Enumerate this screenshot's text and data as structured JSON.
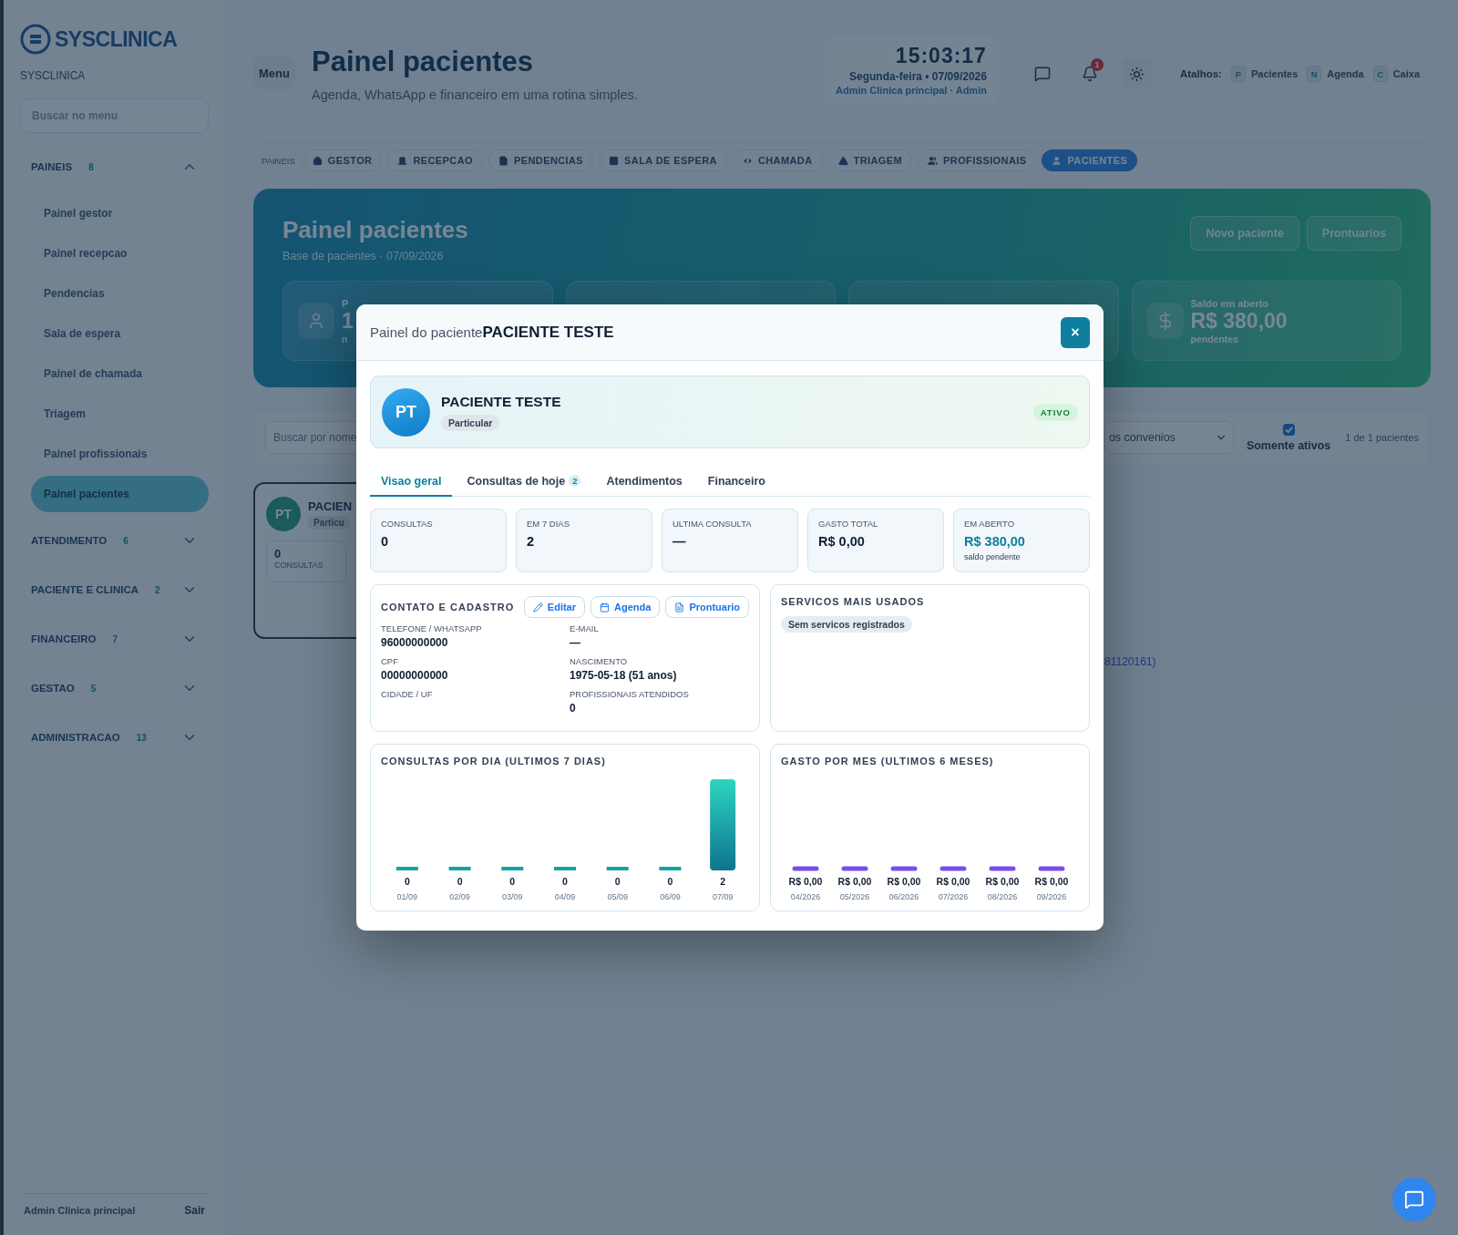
{
  "sidebar": {
    "logo": "SYSCLINICA",
    "subtitle": "SYSCLINICA",
    "search": {
      "placeholder": "Buscar no menu"
    },
    "groups": [
      {
        "label": "PAINEIS",
        "count": "8",
        "expanded": true,
        "items": [
          {
            "label": "Painel gestor",
            "selected": false
          },
          {
            "label": "Painel recepcao",
            "selected": false
          },
          {
            "label": "Pendencias",
            "selected": false
          },
          {
            "label": "Sala de espera",
            "selected": false
          },
          {
            "label": "Painel de chamada",
            "selected": false
          },
          {
            "label": "Triagem",
            "selected": false
          },
          {
            "label": "Painel profissionais",
            "selected": false
          },
          {
            "label": "Painel pacientes",
            "selected": true
          }
        ]
      },
      {
        "label": "ATENDIMENTO",
        "count": "6",
        "expanded": false
      },
      {
        "label": "PACIENTE E CLINICA",
        "count": "2",
        "expanded": false
      },
      {
        "label": "FINANCEIRO",
        "count": "7",
        "expanded": false
      },
      {
        "label": "GESTAO",
        "count": "5",
        "expanded": false
      },
      {
        "label": "ADMINISTRACAO",
        "count": "13",
        "expanded": false
      }
    ],
    "footer": {
      "user": "Admin Clinica principal",
      "logout": "Sair"
    }
  },
  "header": {
    "menu_button": "Menu",
    "title": "Painel pacientes",
    "subtitle": "Agenda, WhatsApp e financeiro em uma rotina simples.",
    "clock": {
      "time": "15:03:17",
      "date": "Segunda-feira • 07/09/2026",
      "user": "Admin Clinica principal · Admin"
    },
    "notification_count": "1",
    "shortcuts": {
      "label": "Atalhos:",
      "items": [
        {
          "key": "P",
          "label": "Pacientes"
        },
        {
          "key": "N",
          "label": "Agenda"
        },
        {
          "key": "C",
          "label": "Caixa"
        }
      ]
    }
  },
  "panel_tabs": {
    "label": "PAINEIS",
    "items": [
      {
        "label": "GESTOR",
        "selected": false
      },
      {
        "label": "RECEPCAO",
        "selected": false
      },
      {
        "label": "PENDENCIAS",
        "selected": false
      },
      {
        "label": "SALA DE ESPERA",
        "selected": false
      },
      {
        "label": "CHAMADA",
        "selected": false
      },
      {
        "label": "TRIAGEM",
        "selected": false
      },
      {
        "label": "PROFISSIONAIS",
        "selected": false
      },
      {
        "label": "PACIENTES",
        "selected": true
      }
    ]
  },
  "hero": {
    "title": "Painel pacientes",
    "subtitle": "Base de pacientes · 07/09/2026",
    "actions": [
      "Novo paciente",
      "Prontuarios"
    ],
    "stats": [
      {
        "label": "P",
        "value": "1",
        "note": "n"
      },
      {
        "label": "Saldo em aberto",
        "value": "R$ 380,00",
        "note": "pendentes"
      }
    ]
  },
  "filters": {
    "search": {
      "placeholder": "Buscar por nome"
    },
    "convenio": "os convenios",
    "only_active": {
      "label": "Somente ativos",
      "checked": true
    },
    "count": "1 de 1 pacientes"
  },
  "patient_card": {
    "initials": "PT",
    "name": "PACIEN",
    "plan": "Particu",
    "consultas": {
      "value": "0",
      "label": "CONSULTAS"
    }
  },
  "list_fragment": "81120161)",
  "modal": {
    "title_prefix": "Painel do paciente",
    "title_name": "PACIENTE TESTE",
    "close": "×",
    "patient": {
      "initials": "PT",
      "name": "PACIENTE TESTE",
      "plan": "Particular",
      "status": "ATIVO"
    },
    "tabs": [
      {
        "label": "Visao geral",
        "selected": true
      },
      {
        "label": "Consultas de hoje",
        "badge": "2",
        "selected": false
      },
      {
        "label": "Atendimentos",
        "selected": false
      },
      {
        "label": "Financeiro",
        "selected": false
      }
    ],
    "metrics": [
      {
        "label": "CONSULTAS",
        "value": "0"
      },
      {
        "label": "EM 7 DIAS",
        "value": "2"
      },
      {
        "label": "ULTIMA CONSULTA",
        "value": "—"
      },
      {
        "label": "GASTO TOTAL",
        "value": "R$ 0,00"
      },
      {
        "label": "EM ABERTO",
        "value": "R$ 380,00",
        "note": "saldo pendente",
        "highlight": true
      }
    ],
    "contact": {
      "title": "CONTATO E CADASTRO",
      "actions": [
        "Editar",
        "Agenda",
        "Prontuario"
      ],
      "fields": [
        {
          "label": "TELEFONE / WHATSAPP",
          "value": "96000000000"
        },
        {
          "label": "E-MAIL",
          "value": "—"
        },
        {
          "label": "CPF",
          "value": "00000000000"
        },
        {
          "label": "NASCIMENTO",
          "value": "1975-05-18 (51 anos)"
        },
        {
          "label": "CIDADE / UF"
        },
        {
          "label": "PROFISSIONAIS ATENDIDOS",
          "value": "0"
        }
      ]
    },
    "services": {
      "title": "SERVICOS MAIS USADOS",
      "empty": "Sem servicos registrados"
    },
    "charts": [
      {
        "chart_data": {
          "type": "bar",
          "title": "CONSULTAS POR DIA (ULTIMOS 7 DIAS)",
          "categories": [
            "01/09",
            "02/09",
            "03/09",
            "04/09",
            "05/09",
            "06/09",
            "07/09"
          ],
          "values": [
            0,
            0,
            0,
            0,
            0,
            0,
            2
          ],
          "data_labels": true
        }
      },
      {
        "chart_data": {
          "type": "other",
          "title": "GASTO POR MES (ULTIMOS 6 MESES)",
          "categories": [
            "04/2026",
            "05/2026",
            "06/2026",
            "07/2026",
            "08/2026",
            "09/2026"
          ],
          "values": [
            0,
            0,
            0,
            0,
            0,
            0
          ],
          "value_labels": [
            "R$ 0,00",
            "R$ 0,00",
            "R$ 0,00",
            "R$ 0,00",
            "R$ 0,00",
            "R$ 0,00"
          ]
        }
      }
    ]
  }
}
